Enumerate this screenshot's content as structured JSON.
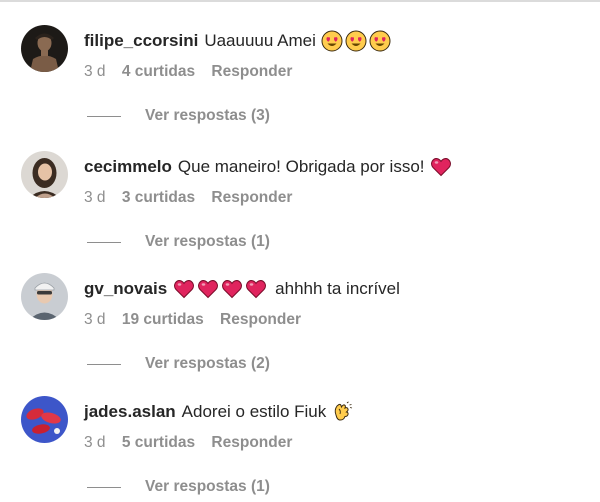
{
  "comments": [
    {
      "username": "filipe_ccorsini",
      "text": "Uaauuuu Amei",
      "emojis_before": [],
      "emojis_after": [
        "heart-eyes",
        "heart-eyes",
        "heart-eyes"
      ],
      "time": "3 d",
      "likes": "4 curtidas",
      "reply": "Responder",
      "view_replies": "Ver respostas (3)"
    },
    {
      "username": "cecimmelo",
      "text": "Que maneiro! Obrigada por isso!",
      "emojis_before": [],
      "emojis_after": [
        "red-heart"
      ],
      "time": "3 d",
      "likes": "3 curtidas",
      "reply": "Responder",
      "view_replies": "Ver respostas (1)"
    },
    {
      "username": "gv_novais",
      "text": "ahhhh ta incrível",
      "emojis_before": [
        "red-heart",
        "red-heart",
        "red-heart",
        "red-heart"
      ],
      "emojis_after": [],
      "time": "3 d",
      "likes": "19 curtidas",
      "reply": "Responder",
      "view_replies": "Ver respostas (2)"
    },
    {
      "username": "jades.aslan",
      "text": "Adorei o estilo Fiuk",
      "emojis_before": [],
      "emojis_after": [
        "clapping-hands"
      ],
      "time": "3 d",
      "likes": "5 curtidas",
      "reply": "Responder",
      "view_replies": "Ver respostas (1)"
    }
  ],
  "colors": {
    "text": "#262626",
    "secondary": "#8e8e8e",
    "heart": "#e0245e",
    "emoji_yellow": "#ffcc4d"
  }
}
